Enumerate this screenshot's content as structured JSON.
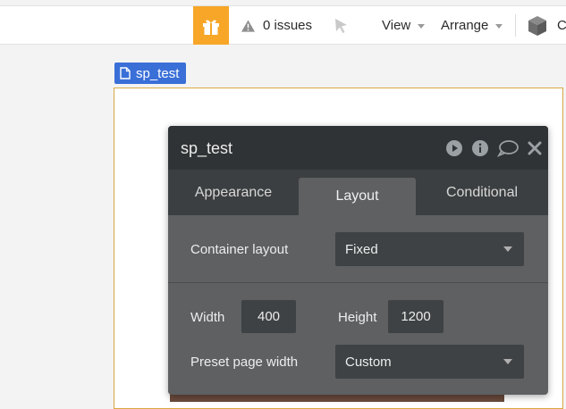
{
  "toolbar": {
    "issues_label": "0 issues",
    "view_label": "View",
    "arrange_label": "Arrange",
    "truncated_label": "C"
  },
  "canvas": {
    "page_tag": "sp_test"
  },
  "panel": {
    "title": "sp_test",
    "tabs": [
      "Appearance",
      "Layout",
      "Conditional"
    ],
    "active_tab": "Layout",
    "container_layout_label": "Container layout",
    "container_layout_value": "Fixed",
    "width_label": "Width",
    "width_value": "400",
    "height_label": "Height",
    "height_value": "1200",
    "preset_label": "Preset page width",
    "preset_value": "Custom"
  },
  "colors": {
    "gift_accent": "#f7a628",
    "page_tag": "#3a6fd8",
    "panel_header": "#2f3335",
    "panel_body": "#5e6061"
  },
  "icons": [
    "gift-icon",
    "warning-icon",
    "pointer-icon",
    "cube-icon",
    "page-icon",
    "play-icon",
    "info-icon",
    "comment-icon",
    "close-icon"
  ]
}
